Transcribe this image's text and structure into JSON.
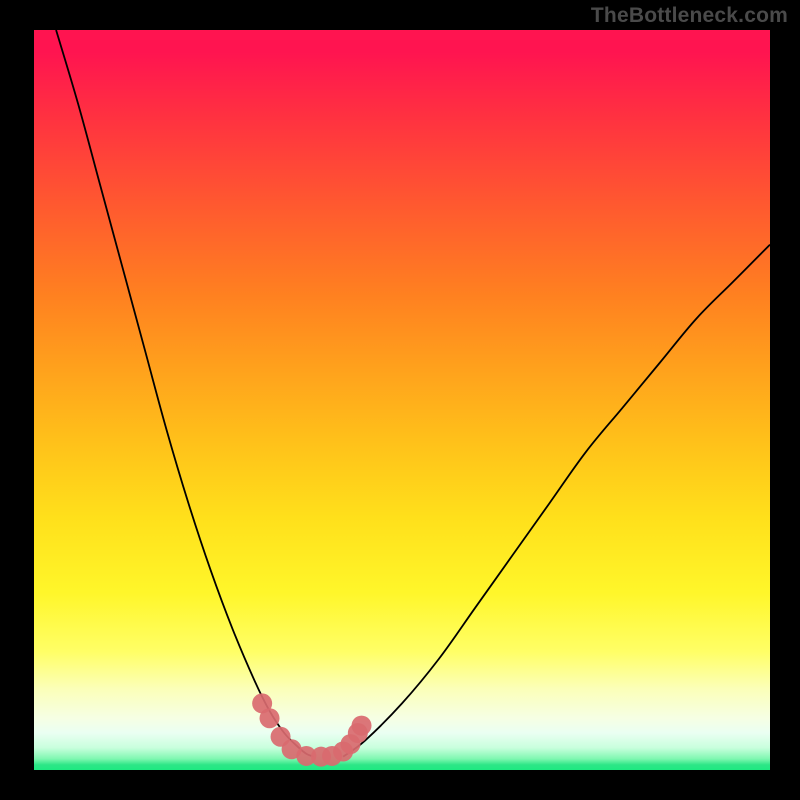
{
  "watermark": "TheBottleneck.com",
  "chart_data": {
    "type": "line",
    "title": "",
    "xlabel": "",
    "ylabel": "",
    "xlim": [
      0,
      100
    ],
    "ylim": [
      0,
      100
    ],
    "grid": false,
    "legend": false,
    "series": [
      {
        "name": "left-branch",
        "x": [
          3,
          6,
          9,
          12,
          15,
          18,
          21,
          24,
          27,
          30,
          32,
          34,
          36,
          37,
          38
        ],
        "y": [
          100,
          90,
          79,
          68,
          57,
          46,
          36,
          27,
          19,
          12,
          8,
          5,
          3,
          2.2,
          1.8
        ]
      },
      {
        "name": "right-branch",
        "x": [
          42,
          45,
          50,
          55,
          60,
          65,
          70,
          75,
          80,
          85,
          90,
          95,
          100
        ],
        "y": [
          1.8,
          4,
          9,
          15,
          22,
          29,
          36,
          43,
          49,
          55,
          61,
          66,
          71
        ]
      },
      {
        "name": "markers",
        "type": "scatter",
        "x": [
          31.0,
          32.0,
          33.5,
          35.0,
          37.0,
          39.0,
          40.5,
          42.0,
          43.0,
          44.0,
          44.5
        ],
        "y": [
          9.0,
          7.0,
          4.5,
          2.8,
          1.9,
          1.8,
          1.9,
          2.5,
          3.5,
          5.0,
          6.0
        ],
        "color": "#d96a6f",
        "size": 20
      }
    ],
    "colors": {
      "curve": "#000000",
      "markers": "#d96a6f",
      "background_top": "#ff1450",
      "background_bottom": "#1de981"
    }
  }
}
